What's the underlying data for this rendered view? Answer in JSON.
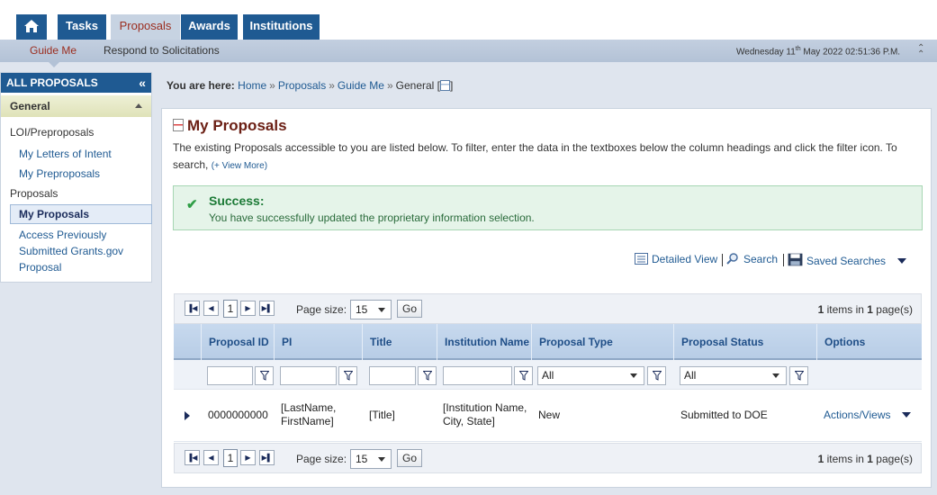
{
  "nav": {
    "tabs": [
      {
        "label": "Tasks"
      },
      {
        "label": "Proposals"
      },
      {
        "label": "Awards"
      },
      {
        "label": "Institutions"
      }
    ],
    "home_icon": "home-icon"
  },
  "subnav": {
    "guide_me": "Guide Me",
    "respond": "Respond to Solicitations",
    "datetime_prefix": "Wednesday 11",
    "datetime_sup": "th",
    "datetime_suffix": " May 2022 02:51:36 P.M."
  },
  "sidebar": {
    "header": "ALL PROPOSALS",
    "section": "General",
    "group1": "LOI/Preproposals",
    "link_letters": "My Letters of Intent",
    "link_preproposals": "My Preproposals",
    "group2": "Proposals",
    "active": "My Proposals",
    "link_access": "Access Previously Submitted Grants.gov Proposal"
  },
  "breadcrumb": {
    "prefix": "You are here:",
    "home": "Home",
    "proposals": "Proposals",
    "guide": "Guide Me",
    "current": "General [",
    "close": "]"
  },
  "main": {
    "title": "My Proposals",
    "description": "The existing Proposals accessible to you are listed below. To filter, enter the data in the textboxes below the column headings and click the filter icon. To search, ",
    "view_more": "(+ View More)",
    "success_title": "Success:",
    "success_message": "You have successfully updated the proprietary information selection."
  },
  "tools": {
    "detailed_view": "Detailed View",
    "search": "Search",
    "saved_searches": "Saved Searches"
  },
  "pager": {
    "page": "1",
    "size_label": "Page size:",
    "size_value": "15",
    "go": "Go",
    "items_count": "1",
    "items_text": " items in ",
    "pages_count": "1",
    "pages_text": " page(s)"
  },
  "table": {
    "headers": [
      "Proposal ID",
      "PI",
      "Title",
      "Institution Name",
      "Proposal Type",
      "Proposal Status",
      "Options"
    ],
    "filter_all_type": "All",
    "filter_all_status": "All",
    "rows": [
      {
        "id": "0000000000",
        "pi": "[LastName, FirstName]",
        "title": "[Title]",
        "institution": "[Institution Name, City, State]",
        "type": "New",
        "status": "Submitted to DOE",
        "options": "Actions/Views"
      }
    ]
  },
  "colors": {
    "brand_blue": "#1f5a92",
    "title_maroon": "#6b1f14",
    "success_green": "#1c7a36"
  }
}
